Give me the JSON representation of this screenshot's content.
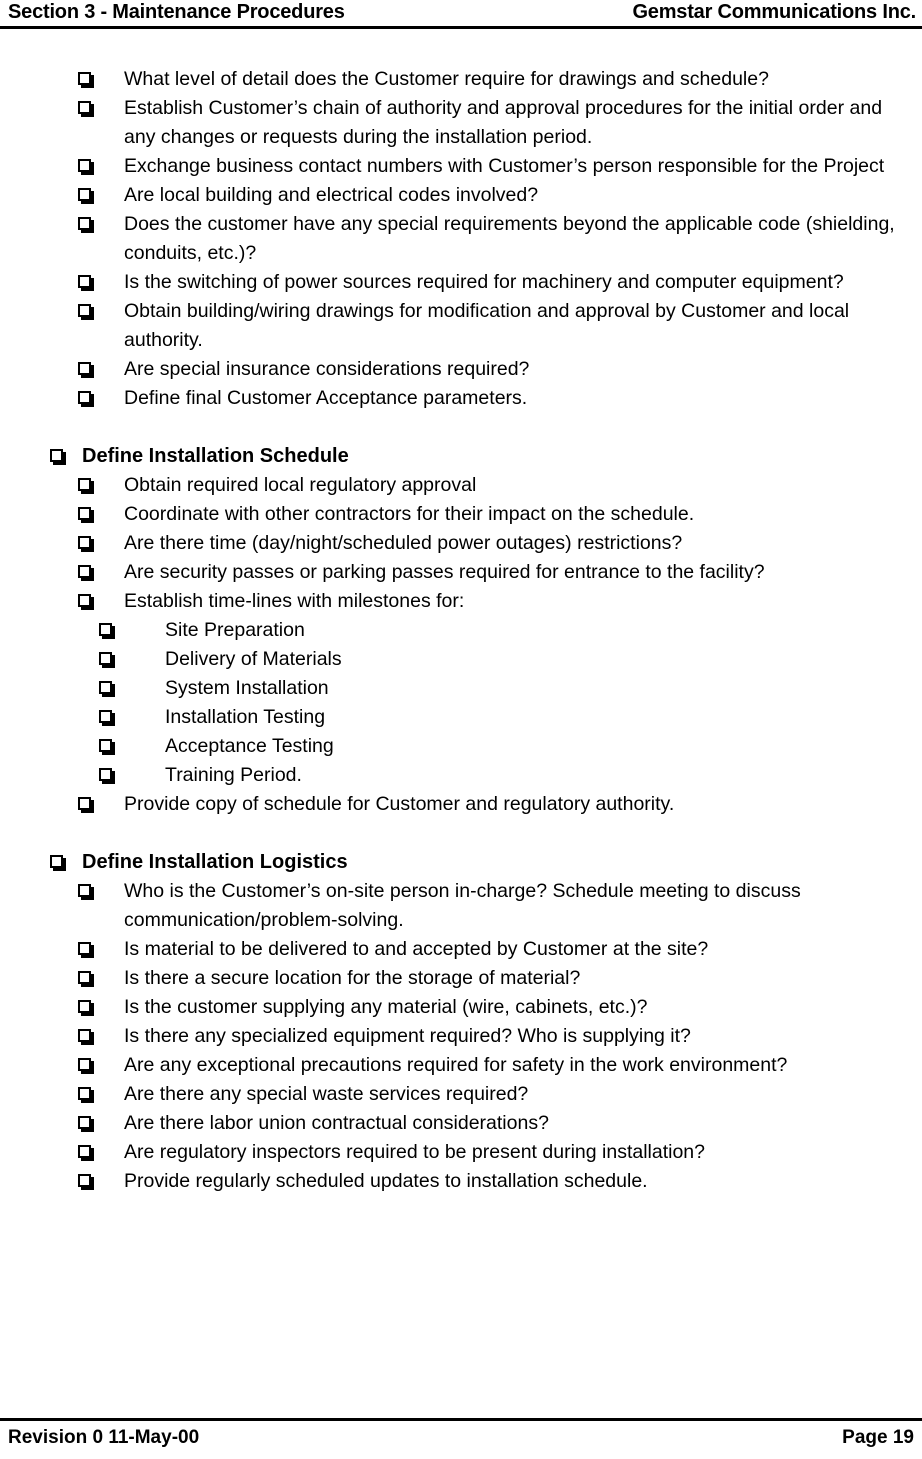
{
  "header": {
    "left": "Section 3 - Maintenance Procedures",
    "right": "Gemstar Communications Inc."
  },
  "footer": {
    "left": "Revision 0  11-May-00",
    "right": "Page 19"
  },
  "document": {
    "bullet_glyph": "checkbox-square",
    "blocks": [
      {
        "level": 2,
        "text": "What level of detail does the Customer require for drawings and schedule?"
      },
      {
        "level": 2,
        "text": "Establish Customer’s chain of authority and approval procedures for the initial order and any changes or requests during the installation period."
      },
      {
        "level": 2,
        "text": "Exchange business contact numbers with Customer’s person responsible for the Project"
      },
      {
        "level": 2,
        "text": "Are local building and electrical codes involved?"
      },
      {
        "level": 2,
        "text": "Does the customer have any special requirements beyond the applicable code (shielding, conduits, etc.)?"
      },
      {
        "level": 2,
        "text": "Is the switching of power sources required for machinery and computer equipment?"
      },
      {
        "level": 2,
        "text": "Obtain building/wiring drawings for modification and approval by Customer and local authority."
      },
      {
        "level": 2,
        "text": "Are special insurance considerations required?"
      },
      {
        "level": 2,
        "text": "Define final Customer Acceptance parameters."
      },
      {
        "level": 0,
        "text": ""
      },
      {
        "level": 1,
        "text": "Define Installation Schedule"
      },
      {
        "level": 2,
        "text": "Obtain required local regulatory approval"
      },
      {
        "level": 2,
        "text": "Coordinate with other contractors for their impact on the schedule."
      },
      {
        "level": 2,
        "text": "Are there time (day/night/scheduled power outages) restrictions?"
      },
      {
        "level": 2,
        "text": "Are security passes or parking passes required for entrance to the facility?"
      },
      {
        "level": 2,
        "text": "Establish time-lines with milestones for:"
      },
      {
        "level": 3,
        "text": "Site Preparation"
      },
      {
        "level": 3,
        "text": "Delivery of Materials"
      },
      {
        "level": 3,
        "text": "System Installation"
      },
      {
        "level": 3,
        "text": "Installation Testing"
      },
      {
        "level": 3,
        "text": "Acceptance Testing"
      },
      {
        "level": 3,
        "text": "Training Period."
      },
      {
        "level": 2,
        "text": "Provide copy of schedule for Customer and regulatory authority."
      },
      {
        "level": 0,
        "text": ""
      },
      {
        "level": 1,
        "text": "Define Installation Logistics"
      },
      {
        "level": 2,
        "text": "Who is the Customer’s on-site person in-charge?  Schedule meeting to discuss communication/problem-solving."
      },
      {
        "level": 2,
        "text": "Is material to be delivered to and accepted by Customer at the site?"
      },
      {
        "level": 2,
        "text": "Is there a secure location for the storage of material?"
      },
      {
        "level": 2,
        "text": "Is the customer supplying any material (wire, cabinets, etc.)?"
      },
      {
        "level": 2,
        "text": "Is there any specialized equipment required?  Who is supplying it?"
      },
      {
        "level": 2,
        "text": "Are any exceptional precautions required for safety in the work environment?"
      },
      {
        "level": 2,
        "text": "Are there any special waste services required?"
      },
      {
        "level": 2,
        "text": "Are there labor union contractual considerations?"
      },
      {
        "level": 2,
        "text": "Are regulatory inspectors required to be present during installation?"
      },
      {
        "level": 2,
        "text": "Provide regularly scheduled updates to installation schedule."
      }
    ]
  }
}
